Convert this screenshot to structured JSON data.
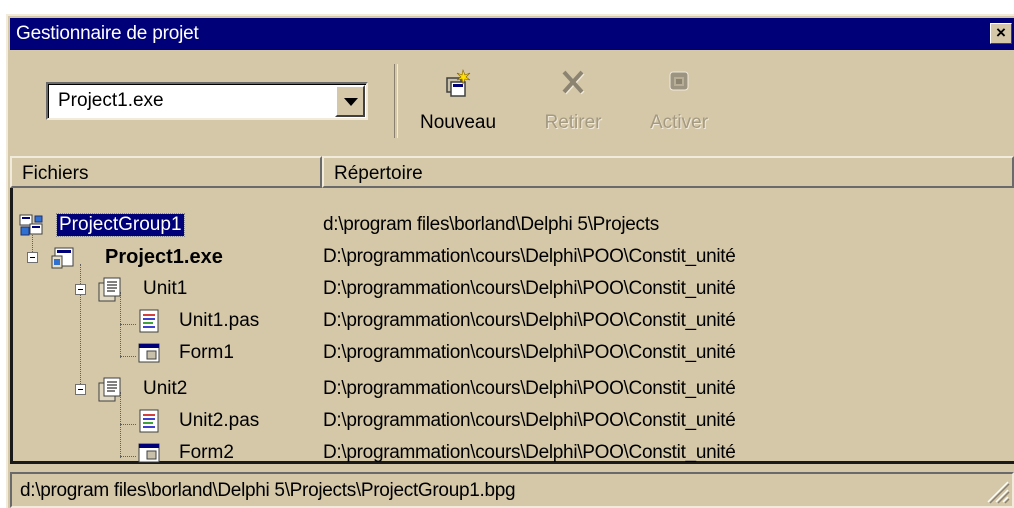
{
  "window": {
    "title": "Gestionnaire de projet"
  },
  "toolbar": {
    "project_combo_value": "Project1.exe",
    "buttons": [
      {
        "label": "Nouveau",
        "icon": "new-project-icon",
        "enabled": true
      },
      {
        "label": "Retirer",
        "icon": "remove-x-icon",
        "enabled": false
      },
      {
        "label": "Activer",
        "icon": "activate-icon",
        "enabled": false
      }
    ]
  },
  "columns": {
    "files": "Fichiers",
    "directory": "Répertoire"
  },
  "tree": [
    {
      "name": "ProjectGroup1",
      "dir": "d:\\program files\\borland\\Delphi 5\\Projects",
      "level": 0,
      "icon": "project-group-icon",
      "selected": true
    },
    {
      "name": "Project1.exe",
      "dir": "D:\\programmation\\cours\\Delphi\\POO\\Constit_unité",
      "level": 1,
      "icon": "project-icon",
      "bold": true,
      "expanded": true
    },
    {
      "name": "Unit1",
      "dir": "D:\\programmation\\cours\\Delphi\\POO\\Constit_unité",
      "level": 2,
      "icon": "unit-icon",
      "expanded": true
    },
    {
      "name": "Unit1.pas",
      "dir": "D:\\programmation\\cours\\Delphi\\POO\\Constit_unité",
      "level": 3,
      "icon": "pas-file-icon"
    },
    {
      "name": "Form1",
      "dir": "D:\\programmation\\cours\\Delphi\\POO\\Constit_unité",
      "level": 3,
      "icon": "form-icon"
    },
    {
      "name": "Unit2",
      "dir": "D:\\programmation\\cours\\Delphi\\POO\\Constit_unité",
      "level": 2,
      "icon": "unit-icon",
      "expanded": true
    },
    {
      "name": "Unit2.pas",
      "dir": "D:\\programmation\\cours\\Delphi\\POO\\Constit_unité",
      "level": 3,
      "icon": "pas-file-icon"
    },
    {
      "name": "Form2",
      "dir": "D:\\programmation\\cours\\Delphi\\POO\\Constit_unité",
      "level": 3,
      "icon": "form-icon"
    }
  ],
  "status": {
    "path": "d:\\program files\\borland\\Delphi 5\\Projects\\ProjectGroup1.bpg"
  },
  "colors": {
    "titlebar": "#000078",
    "face": "#d4c8a8",
    "selection": "#000078"
  }
}
